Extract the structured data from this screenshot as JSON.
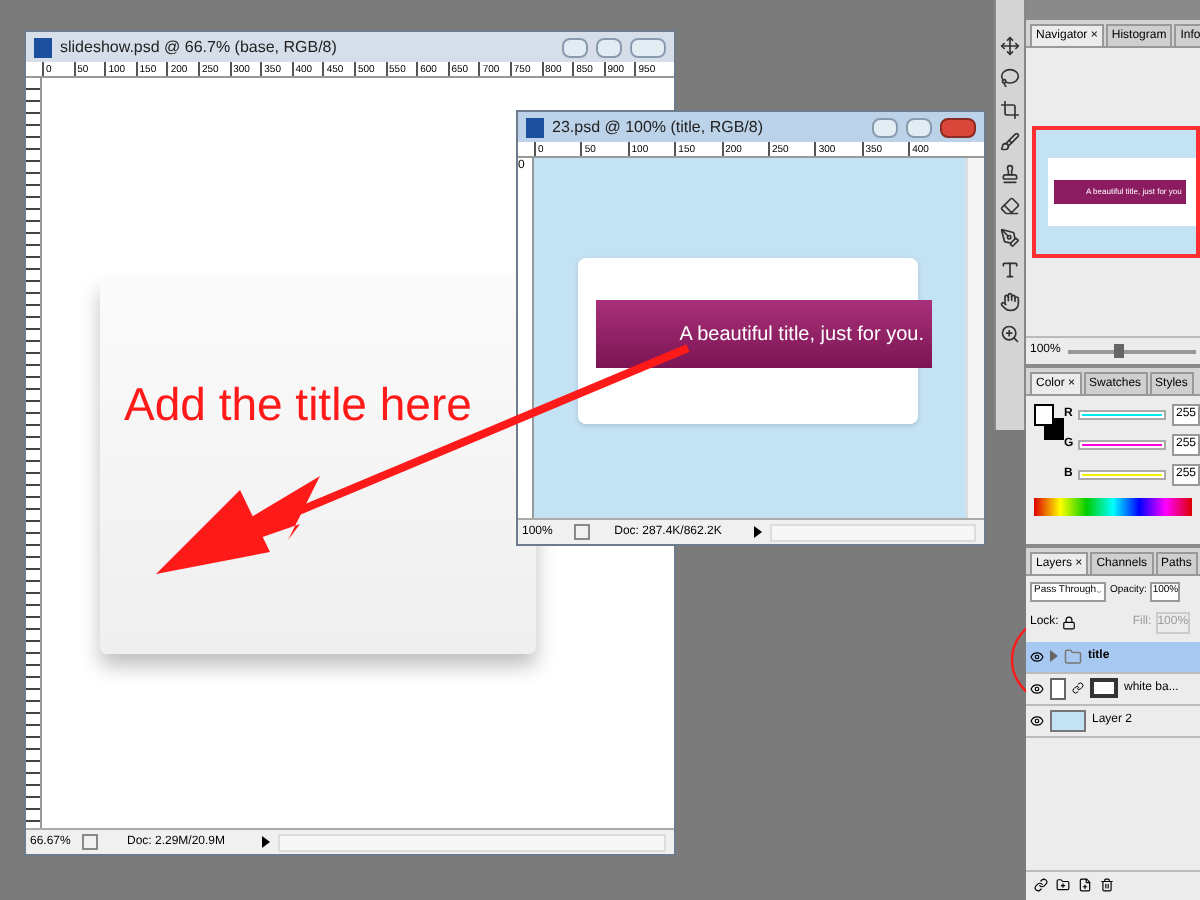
{
  "slideshow_window": {
    "title": "slideshow.psd @ 66.7% (base, RGB/8)",
    "ruler_marks": [
      "0",
      "50",
      "100",
      "150",
      "200",
      "250",
      "300",
      "350",
      "400",
      "450",
      "500",
      "550",
      "600",
      "650",
      "700",
      "750",
      "800",
      "850",
      "900",
      "950"
    ],
    "zoom": "66.67%",
    "doc": "Doc: 2.29M/20.9M"
  },
  "title_window": {
    "title": "23.psd @ 100% (title, RGB/8)",
    "ruler_marks": [
      "0",
      "50",
      "100",
      "150",
      "200",
      "250",
      "300",
      "350",
      "400"
    ],
    "side_ruler_mark": "0",
    "banner": "A beautiful title, just for you.",
    "zoom": "100%",
    "doc": "Doc: 287.4K/862.2K"
  },
  "annotation": "Add the title here",
  "navigator": {
    "tabs": [
      {
        "label": "Navigator ×",
        "selected": true
      },
      {
        "label": "Histogram",
        "selected": false
      },
      {
        "label": "Info",
        "selected": false
      }
    ],
    "preview_text": "A beautiful title, just for you",
    "zoom": "100%",
    "level": 0.35
  },
  "color_panel": {
    "tabs": [
      {
        "label": "Color ×",
        "selected": true
      },
      {
        "label": "Swatches",
        "selected": false
      },
      {
        "label": "Styles",
        "selected": false
      }
    ],
    "channels": [
      {
        "label": "R",
        "value": "255",
        "color": "#00e8f0",
        "level": 1
      },
      {
        "label": "G",
        "value": "255",
        "color": "#ff00e0",
        "level": 1
      },
      {
        "label": "B",
        "value": "255",
        "color": "#f0f000",
        "level": 1
      }
    ]
  },
  "layers_panel": {
    "tabs": [
      {
        "label": "Layers ×",
        "selected": true
      },
      {
        "label": "Channels",
        "selected": false
      },
      {
        "label": "Paths",
        "selected": false
      }
    ],
    "blend_mode": "Pass Through",
    "opacity_label": "Opacity:",
    "opacity": "100%",
    "lock_label": "Lock:",
    "fill_label": "Fill:",
    "fill": "100%",
    "layers": [
      {
        "name": "title",
        "kind": "group",
        "selected": true
      },
      {
        "name": "white ba...",
        "kind": "masked",
        "selected": false
      },
      {
        "name": "Layer 2",
        "kind": "plain",
        "selected": false
      }
    ]
  }
}
